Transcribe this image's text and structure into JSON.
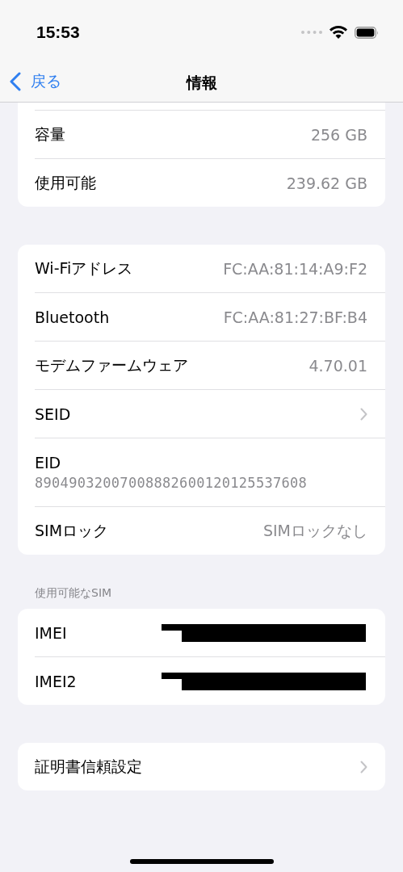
{
  "status_bar": {
    "time": "15:53"
  },
  "nav": {
    "back": "戻る",
    "title": "情報"
  },
  "groups": [
    {
      "cut_top": true,
      "rows": [
        {
          "kind": "value",
          "label": "容量",
          "value": "256 GB"
        },
        {
          "kind": "value",
          "label": "使用可能",
          "value": "239.62 GB"
        }
      ]
    },
    {
      "rows": [
        {
          "kind": "value",
          "label": "Wi-Fiアドレス",
          "value": "FC:AA:81:14:A9:F2"
        },
        {
          "kind": "value",
          "label": "Bluetooth",
          "value": "FC:AA:81:27:BF:B4"
        },
        {
          "kind": "value",
          "label": "モデムファームウェア",
          "value": "4.70.01"
        },
        {
          "kind": "chevron",
          "label": "SEID"
        },
        {
          "kind": "stacked",
          "label": "EID",
          "value": "89049032007008882600120125537608"
        },
        {
          "kind": "value",
          "label": "SIMロック",
          "value": "SIMロックなし"
        }
      ]
    },
    {
      "header": "使用可能なSIM",
      "rows": [
        {
          "kind": "redacted",
          "label": "IMEI"
        },
        {
          "kind": "redacted",
          "label": "IMEI2"
        }
      ]
    },
    {
      "rows": [
        {
          "kind": "chevron",
          "label": "証明書信頼設定"
        }
      ]
    }
  ]
}
